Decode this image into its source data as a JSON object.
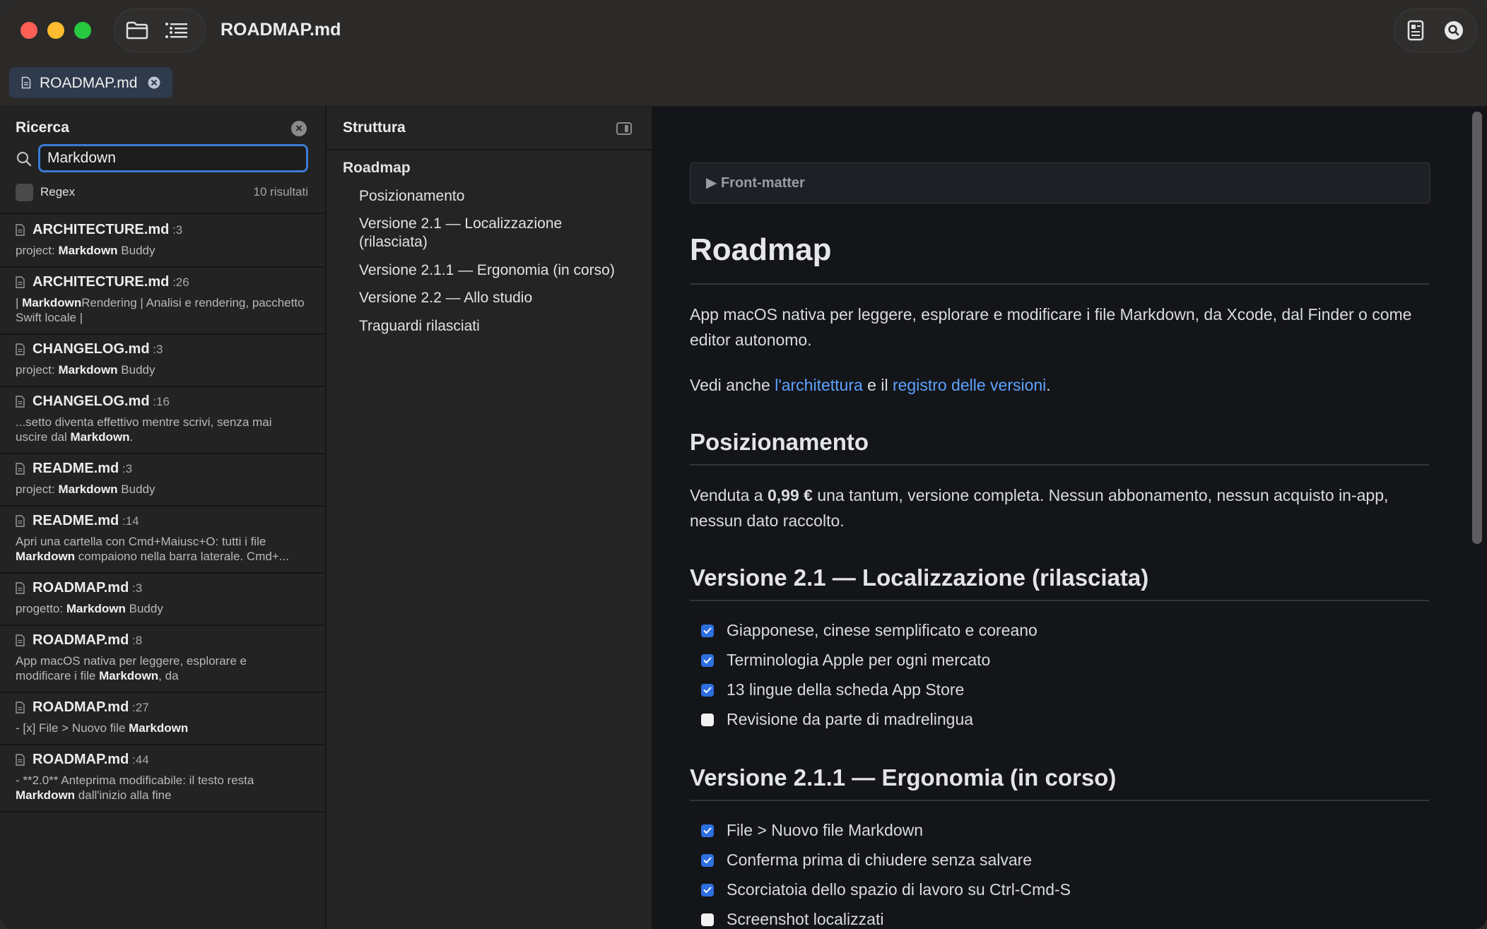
{
  "window": {
    "title": "ROADMAP.md"
  },
  "tab": {
    "label": "ROADMAP.md"
  },
  "search": {
    "title": "Ricerca",
    "query": "Markdown",
    "regex_label": "Regex",
    "result_count": "10 risultati",
    "results": [
      {
        "file": "ARCHITECTURE.md",
        "line": ":3",
        "snippet": "project: <b>Markdown</b> Buddy"
      },
      {
        "file": "ARCHITECTURE.md",
        "line": ":26",
        "snippet": "| <b>Markdown</b>Rendering | Analisi e rendering, pacchetto Swift locale |"
      },
      {
        "file": "CHANGELOG.md",
        "line": ":3",
        "snippet": "project: <b>Markdown</b> Buddy"
      },
      {
        "file": "CHANGELOG.md",
        "line": ":16",
        "snippet": "...setto diventa effettivo mentre scrivi, senza mai uscire dal <b>Markdown</b>."
      },
      {
        "file": "README.md",
        "line": ":3",
        "snippet": "project: <b>Markdown</b> Buddy"
      },
      {
        "file": "README.md",
        "line": ":14",
        "snippet": "Apri una cartella con Cmd+Maiusc+O: tutti i file <b>Markdown</b> compaiono nella barra laterale. Cmd+..."
      },
      {
        "file": "ROADMAP.md",
        "line": ":3",
        "snippet": "progetto: <b>Markdown</b> Buddy"
      },
      {
        "file": "ROADMAP.md",
        "line": ":8",
        "snippet": "App macOS nativa per leggere, esplorare e modificare i file <b>Markdown</b>, da"
      },
      {
        "file": "ROADMAP.md",
        "line": ":27",
        "snippet": "- [x] File &gt; Nuovo file <b>Markdown</b>"
      },
      {
        "file": "ROADMAP.md",
        "line": ":44",
        "snippet": "- **2.0** Anteprima modificabile: il testo resta <b>Markdown</b> dall'inizio alla fine"
      }
    ]
  },
  "outline": {
    "title": "Struttura",
    "items": [
      {
        "label": "Roadmap",
        "level": 1
      },
      {
        "label": "Posizionamento",
        "level": 2
      },
      {
        "label": "Versione 2.1 — Localizzazione (rilasciata)",
        "level": 2
      },
      {
        "label": "Versione 2.1.1 — Ergonomia (in corso)",
        "level": 2
      },
      {
        "label": "Versione 2.2 — Allo studio",
        "level": 2
      },
      {
        "label": "Traguardi rilasciati",
        "level": 2
      }
    ]
  },
  "document": {
    "frontmatter_label": "▶ Front-matter",
    "title": "Roadmap",
    "intro": "App macOS nativa per leggere, esplorare e modificare i file Markdown, da Xcode, dal Finder o come editor autonomo.",
    "see_also_prefix": "Vedi anche ",
    "see_also_link1": "l'architettura",
    "see_also_mid": " e il ",
    "see_also_link2": "registro delle versioni",
    "see_also_suffix": ".",
    "positioning_heading": "Posizionamento",
    "positioning_prefix": "Venduta a ",
    "positioning_price": "0,99 €",
    "positioning_suffix": " una tantum, versione completa. Nessun abbonamento, nessun acquisto in-app, nessun dato raccolto.",
    "v21_heading": "Versione 2.1 — Localizzazione (rilasciata)",
    "v21_tasks": [
      {
        "label": "Giapponese, cinese semplificato e coreano",
        "done": true
      },
      {
        "label": "Terminologia Apple per ogni mercato",
        "done": true
      },
      {
        "label": "13 lingue della scheda App Store",
        "done": true
      },
      {
        "label": "Revisione da parte di madrelingua",
        "done": false
      }
    ],
    "v211_heading": "Versione 2.1.1 — Ergonomia (in corso)",
    "v211_tasks": [
      {
        "label": "File > Nuovo file Markdown",
        "done": true
      },
      {
        "label": "Conferma prima di chiudere senza salvare",
        "done": true
      },
      {
        "label": "Scorciatoia dello spazio di lavoro su Ctrl-Cmd-S",
        "done": true
      },
      {
        "label": "Screenshot localizzati",
        "done": false
      }
    ]
  }
}
